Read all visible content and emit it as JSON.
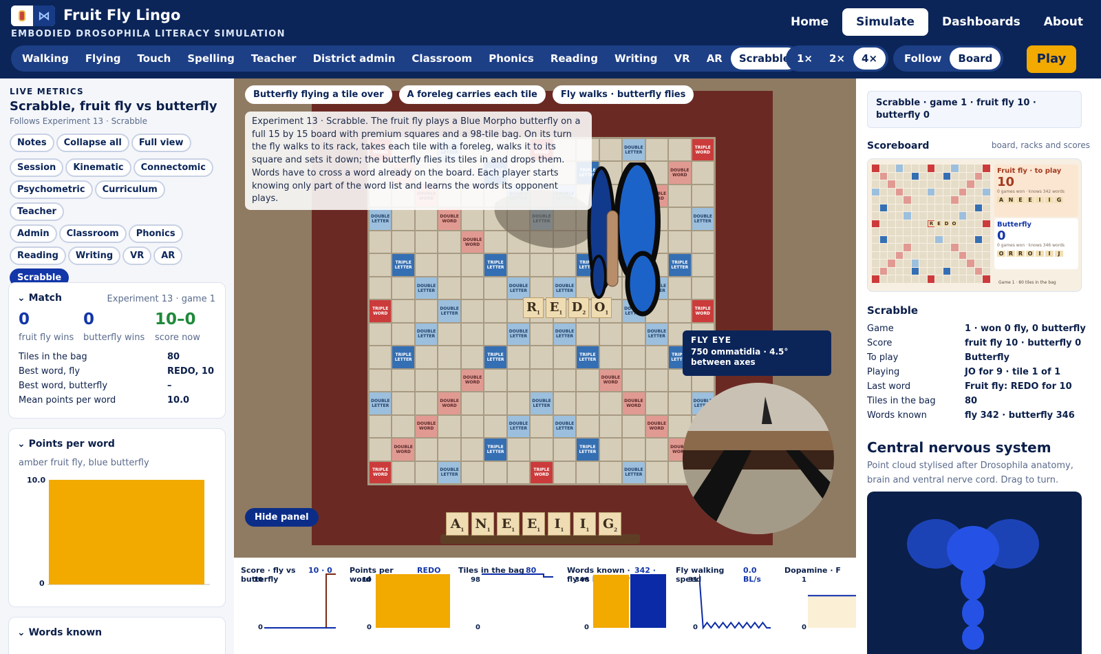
{
  "app": {
    "title": "Fruit Fly Lingo",
    "subtitle": "EMBODIED DROSOPHILA LITERACY SIMULATION"
  },
  "topnav": [
    "Home",
    "Simulate",
    "Dashboards",
    "About"
  ],
  "modes": [
    "Walking",
    "Flying",
    "Touch",
    "Spelling",
    "Teacher",
    "District admin",
    "Classroom",
    "Phonics",
    "Reading",
    "Writing",
    "VR",
    "AR",
    "Scrabble"
  ],
  "speeds": [
    "1×",
    "2×",
    "4×"
  ],
  "camera": [
    "Follow",
    "Board"
  ],
  "play_label": "Play",
  "left": {
    "section_label": "LIVE METRICS",
    "title": "Scrabble, fruit fly vs butterfly",
    "subtitle": "Follows Experiment 13 · Scrabble",
    "view_chips": [
      "Notes",
      "Collapse all",
      "Full view"
    ],
    "panel_chips": [
      "Session",
      "Kinematic",
      "Connectomic",
      "Psychometric",
      "Curriculum",
      "Teacher",
      "Admin",
      "Classroom",
      "Phonics",
      "Reading",
      "Writing",
      "VR",
      "AR",
      "Scrabble"
    ],
    "match": {
      "title": "Match",
      "meta": "Experiment 13 · game 1",
      "fly_wins": "0",
      "fly_wins_label": "fruit fly wins",
      "bf_wins": "0",
      "bf_wins_label": "butterfly wins",
      "score_now": "10–0",
      "score_now_label": "score now",
      "rows": [
        {
          "k": "Tiles in the bag",
          "v": "80"
        },
        {
          "k": "Best word, fly",
          "v": "REDO, 10"
        },
        {
          "k": "Best word, butterfly",
          "v": "–"
        },
        {
          "k": "Mean points per word",
          "v": "10.0"
        }
      ]
    },
    "ppw": {
      "title": "Points per word",
      "subtitle": "amber fruit fly, blue butterfly",
      "ymax": "10.0",
      "ymin": "0"
    },
    "words_known": {
      "title": "Words known"
    }
  },
  "stage": {
    "pills": [
      "Butterfly flying a tile over",
      "A foreleg carries each tile",
      "Fly walks · butterfly flies"
    ],
    "description": "Experiment 13 · Scrabble. The fruit fly plays a Blue Morpho butterfly on a full 15 by 15 board with premium squares and a 98-tile bag. On its turn the fly walks to its rack, takes each tile with a foreleg, walks it to its square and sets it down; the butterfly flies its tiles in and drops them. Words have to cross a word already on the board. Each player starts knowing only part of the word list and learns the words its opponent plays.",
    "hide_label": "Hide panel",
    "eye_title": "FLY EYE",
    "eye_text": "750 ommatidia · 4.5° between axes",
    "board_word": [
      {
        "l": "R",
        "p": "1"
      },
      {
        "l": "E",
        "p": "1"
      },
      {
        "l": "D",
        "p": "2"
      },
      {
        "l": "O",
        "p": "1"
      }
    ],
    "rack": [
      {
        "l": "A",
        "p": "1"
      },
      {
        "l": "N",
        "p": "1"
      },
      {
        "l": "E",
        "p": "1"
      },
      {
        "l": "E",
        "p": "1"
      },
      {
        "l": "I",
        "p": "1"
      },
      {
        "l": "I",
        "p": "1"
      },
      {
        "l": "G",
        "p": "2"
      }
    ],
    "premium_labels": {
      "tw": "TRIPLE WORD",
      "dw": "DOUBLE WORD",
      "tl": "TRIPLE LETTER",
      "dl": "DOUBLE LETTER"
    }
  },
  "strip": [
    {
      "title": "Score · fly vs butterfly",
      "value": "10 · 0",
      "ymax": "10",
      "ymin": "0"
    },
    {
      "title": "Points per word",
      "value": "REDO 10",
      "ymax": "10",
      "ymin": "0"
    },
    {
      "title": "Tiles in the bag",
      "value": "80",
      "ymax": "98",
      "ymin": "0"
    },
    {
      "title": "Words known · fly vs butterfly",
      "value": "342 · 346",
      "ymax": "346",
      "ymin": "0"
    },
    {
      "title": "Fly walking speed",
      "value": "0.0 BL/s",
      "ymax": "31",
      "ymin": "0"
    },
    {
      "title": "Dopamine · F",
      "value": "",
      "ymax": "1",
      "ymin": "0"
    }
  ],
  "right": {
    "status": "Scrabble · game 1 · fruit fly 10 · butterfly 0",
    "scoreboard_title": "Scoreboard",
    "scoreboard_meta": "board, racks and scores",
    "mini": {
      "fly_label": "Fruit fly · to play",
      "fly_score": "10",
      "fly_sub": "0 games won · knows 342 words",
      "bf_label": "Butterfly",
      "bf_score": "0",
      "bf_sub": "0 games won · knows 346 words",
      "foot": "Game 1 · 80 tiles in the bag",
      "fly_rack": [
        "A",
        "N",
        "E",
        "E",
        "I",
        "I",
        "G"
      ],
      "bf_rack": [
        "O",
        "R",
        "R",
        "O",
        "I",
        "I",
        "J"
      ],
      "word": [
        "R",
        "E",
        "D",
        "O"
      ]
    },
    "scrabble_title": "Scrabble",
    "rows": [
      {
        "k": "Game",
        "v": "1 · won 0 fly, 0 butterfly"
      },
      {
        "k": "Score",
        "v": "fruit fly 10 · butterfly 0"
      },
      {
        "k": "To play",
        "v": "Butterfly"
      },
      {
        "k": "Playing",
        "v": "JO for 9 · tile 1 of 1"
      },
      {
        "k": "Last word",
        "v": "Fruit fly: REDO for 10"
      },
      {
        "k": "Tiles in the bag",
        "v": "80"
      },
      {
        "k": "Words known",
        "v": "fly 342 · butterfly 346"
      }
    ],
    "cns_title": "Central nervous system",
    "cns_text": "Point cloud stylised after Drosophila anatomy, brain and ventral nerve cord. Drag to turn."
  },
  "colors": {
    "navy": "#0b2559",
    "amber": "#f2a900",
    "blue": "#1336a8",
    "green": "#1f8a3b"
  },
  "chart_data": [
    {
      "type": "bar",
      "title": "Points per word",
      "categories": [
        "fruit fly",
        "butterfly"
      ],
      "values": [
        10,
        0
      ],
      "ylim": [
        0,
        10
      ]
    },
    {
      "type": "line",
      "title": "Score · fly vs butterfly",
      "series": [
        {
          "name": "fly",
          "values": [
            0,
            0,
            0,
            10
          ]
        },
        {
          "name": "butterfly",
          "values": [
            0,
            0,
            0,
            0
          ]
        }
      ],
      "ylim": [
        0,
        10
      ]
    },
    {
      "type": "bar",
      "title": "Points per word",
      "categories": [
        "REDO"
      ],
      "values": [
        10
      ],
      "ylim": [
        0,
        10
      ]
    },
    {
      "type": "line",
      "title": "Tiles in the bag",
      "series": [
        {
          "values": [
            98,
            98,
            98,
            80
          ]
        }
      ],
      "ylim": [
        0,
        98
      ]
    },
    {
      "type": "bar",
      "title": "Words known · fly vs butterfly",
      "categories": [
        "fly",
        "butterfly"
      ],
      "values": [
        342,
        346
      ],
      "ylim": [
        0,
        346
      ]
    },
    {
      "type": "line",
      "title": "Fly walking speed",
      "series": [
        {
          "values": [
            31,
            0,
            3,
            0,
            3,
            0,
            3,
            0,
            3,
            0,
            3,
            0,
            3,
            0,
            3,
            0,
            3,
            0,
            0
          ]
        }
      ],
      "ylim": [
        0,
        31
      ]
    },
    {
      "type": "line",
      "title": "Dopamine",
      "series": [
        {
          "values": [
            0.6,
            0.6
          ]
        }
      ],
      "ylim": [
        0,
        1
      ]
    }
  ]
}
